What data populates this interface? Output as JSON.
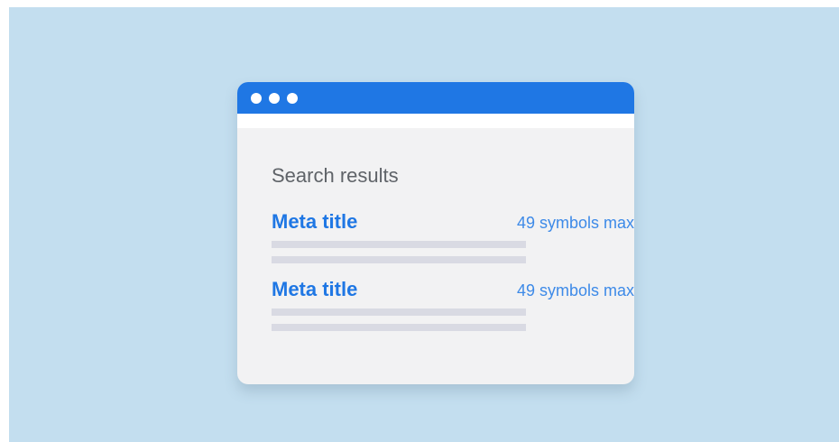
{
  "window": {
    "heading": "Search results"
  },
  "results": [
    {
      "title": "Meta title",
      "limit": "49 symbols max"
    },
    {
      "title": "Meta title",
      "limit": "49 symbols max"
    }
  ],
  "colors": {
    "background": "#c3deef",
    "accent": "#1f77e4",
    "window": "#f2f2f3",
    "placeholder_line": "#d9dae3",
    "heading_text": "#5f6368"
  },
  "icons": {
    "window_controls": [
      "window-dot-icon",
      "window-dot-icon",
      "window-dot-icon"
    ]
  }
}
